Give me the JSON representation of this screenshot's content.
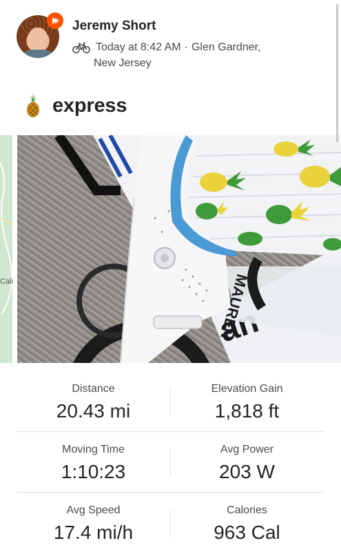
{
  "athlete": {
    "name": "Jeremy Short",
    "time": "Today at 8:42 AM",
    "separator": "·",
    "location_line1": "Glen Gardner,",
    "location_line2": "New Jersey"
  },
  "activity": {
    "title": "express",
    "type_icon": "bike-icon",
    "title_icon": "pineapple-icon"
  },
  "map_peek": {
    "label": "Cali"
  },
  "photo": {
    "frame_text": "MAUREN"
  },
  "stats": [
    {
      "label": "Distance",
      "value": "20.43 mi"
    },
    {
      "label": "Elevation Gain",
      "value": "1,818 ft"
    },
    {
      "label": "Moving Time",
      "value": "1:10:23"
    },
    {
      "label": "Avg Power",
      "value": "203 W"
    },
    {
      "label": "Avg Speed",
      "value": "17.4 mi/h"
    },
    {
      "label": "Calories",
      "value": "963 Cal"
    }
  ],
  "colors": {
    "brand": "#fc5200",
    "text_primary": "#242428",
    "text_secondary": "#494950"
  }
}
